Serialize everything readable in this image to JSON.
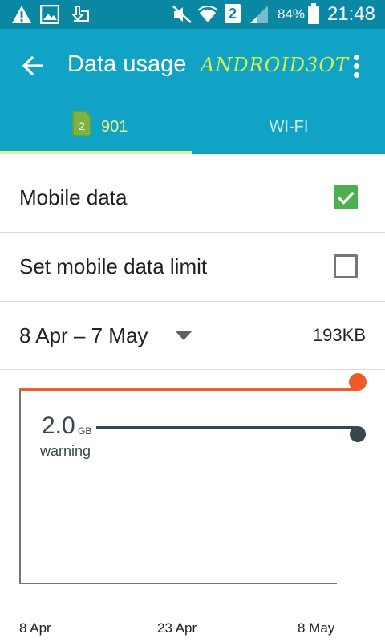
{
  "status_bar": {
    "battery_percent": "84%",
    "sim_number": "2",
    "time": "21:48",
    "icons": [
      "warning-icon",
      "image-icon",
      "download-icon",
      "mute-icon",
      "wifi-icon",
      "sim-2-icon",
      "signal-icon",
      "battery-icon"
    ]
  },
  "app_bar": {
    "title": "Data usage",
    "watermark": "ANDROID3OT",
    "back_icon": "arrow-back-icon",
    "menu_icon": "more-vert-icon"
  },
  "tabs": [
    {
      "label": "901",
      "sim_slot": "2",
      "selected": true
    },
    {
      "label": "WI-FI",
      "selected": false
    }
  ],
  "settings": {
    "mobile_data": {
      "label": "Mobile data",
      "checked": true
    },
    "data_limit": {
      "label": "Set mobile data limit",
      "checked": false
    }
  },
  "cycle": {
    "range": "8 Apr – 7 May",
    "usage": "193KB"
  },
  "chart": {
    "warning_value": "2.0",
    "warning_unit": "GB",
    "warning_caption": "warning",
    "x_ticks": [
      "8 Apr",
      "23 Apr",
      "8 May"
    ]
  },
  "colors": {
    "status_bar": "#0a87a3",
    "app_bar": "#10a3c6",
    "tab_indicator": "#e8ed9a",
    "checkbox_checked": "#4caf50",
    "limit_line": "#f15a24",
    "warning_line": "#37474f"
  }
}
